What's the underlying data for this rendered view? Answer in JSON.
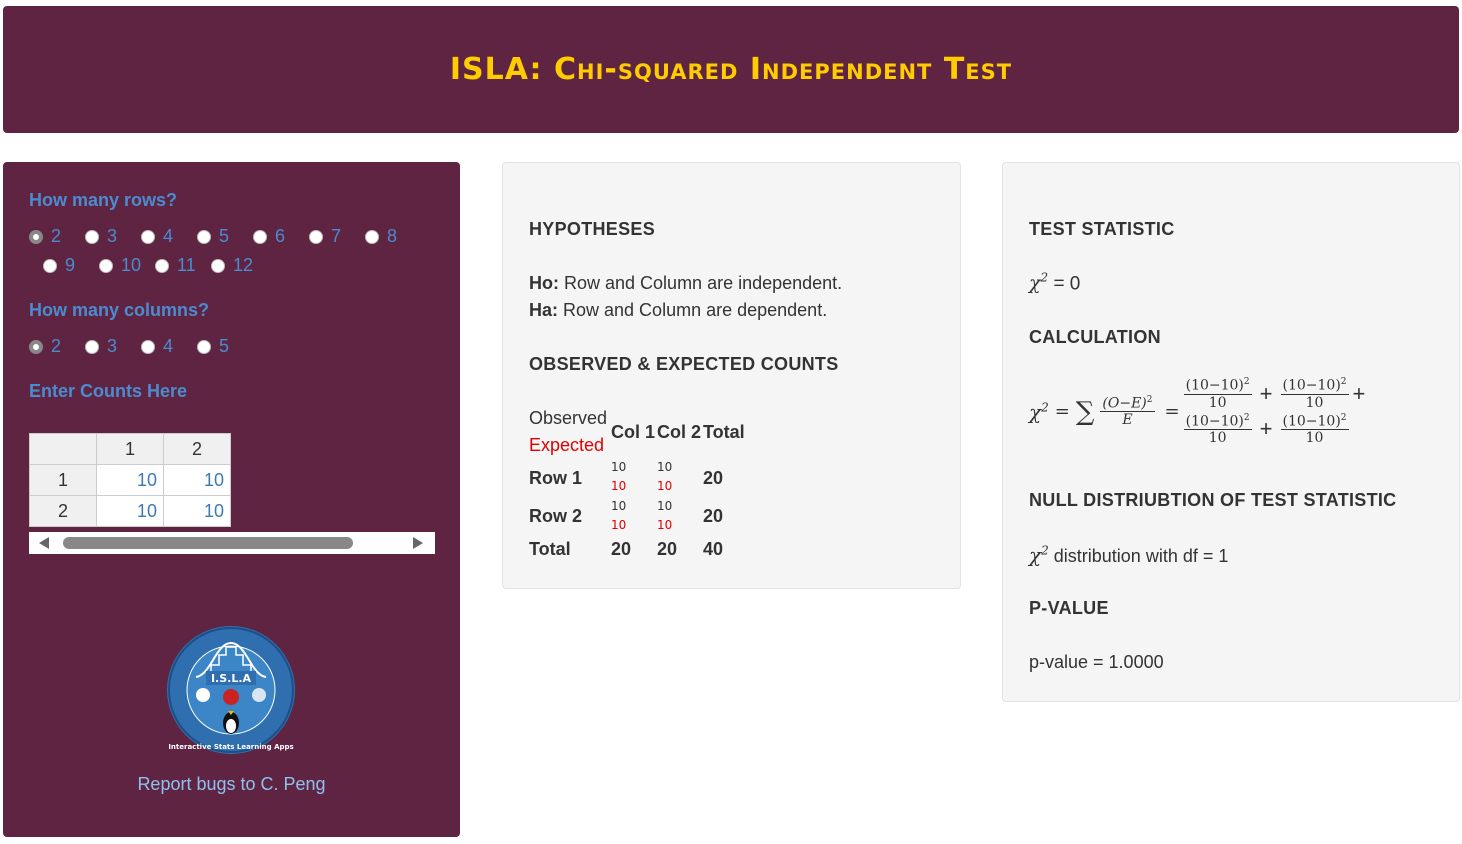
{
  "header": {
    "title": "ISLA: Chi-squared Independent Test"
  },
  "sidebar": {
    "rows_label": "How many rows?",
    "rows_options": [
      "2",
      "3",
      "4",
      "5",
      "6",
      "7",
      "8",
      "9",
      "10",
      "11",
      "12"
    ],
    "rows_selected": "2",
    "cols_label": "How many columns?",
    "cols_options": [
      "2",
      "3",
      "4",
      "5"
    ],
    "cols_selected": "2",
    "counts_label": "Enter Counts Here",
    "table": {
      "col_headers": [
        "",
        "1",
        "2"
      ],
      "rows": [
        {
          "header": "1",
          "values": [
            "10",
            "10"
          ]
        },
        {
          "header": "2",
          "values": [
            "10",
            "10"
          ]
        }
      ]
    },
    "logo_text": "I.S.L.A",
    "logo_ring_text": "Interactive Stats Learning Apps",
    "bug_report": "Report bugs to C. Peng"
  },
  "hypotheses_panel": {
    "hyp_title": "HYPOTHESES",
    "ho_label": "Ho:",
    "ho_text": " Row and Column are independent.",
    "ha_label": "Ha:",
    "ha_text": " Row and Column are dependent.",
    "counts_title": "OBSERVED & EXPECTED COUNTS",
    "observed_label": "Observed",
    "expected_label": "Expected",
    "col_headers": [
      "Col 1",
      "Col 2",
      "Total"
    ],
    "rows": [
      {
        "label": "Row 1",
        "observed": [
          "10",
          "10"
        ],
        "expected": [
          "10",
          "10"
        ],
        "total": "20"
      },
      {
        "label": "Row 2",
        "observed": [
          "10",
          "10"
        ],
        "expected": [
          "10",
          "10"
        ],
        "total": "20"
      }
    ],
    "total_row": {
      "label": "Total",
      "values": [
        "20",
        "20",
        "40"
      ]
    }
  },
  "stats_panel": {
    "test_stat_title": "TEST STATISTIC",
    "test_stat_value": "= 0",
    "calc_title": "CALCULATION",
    "calc_term": "(10−10)",
    "calc_den": "10",
    "null_title": "NULL DISTRIUBTION OF TEST STATISTIC",
    "null_text": " distribution with df = 1",
    "pvalue_title": "P-VALUE",
    "pvalue_text": "p-value = 1.0000"
  },
  "colors": {
    "maroon": "#5f2441",
    "title_gold": "#ffcc00",
    "sidebar_label": "#4a8ccf",
    "expected_red": "#e00000"
  }
}
